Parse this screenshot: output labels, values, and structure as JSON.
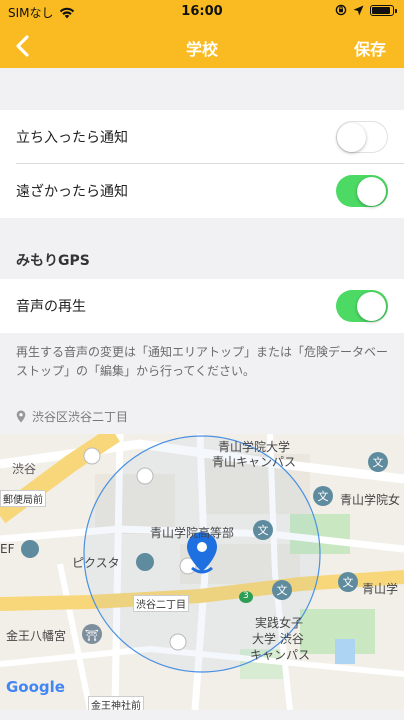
{
  "status_bar": {
    "carrier": "SIMなし",
    "time": "16:00"
  },
  "nav": {
    "back_icon": "chevron-left-icon",
    "title": "学校",
    "save_label": "保存"
  },
  "settings": {
    "notify_enter": {
      "label": "立ち入ったら通知",
      "on": false
    },
    "notify_leave": {
      "label": "遠ざかったら通知",
      "on": true
    }
  },
  "gps_section": {
    "heading": "みもりGPS",
    "voice_playback": {
      "label": "音声の再生",
      "on": true
    },
    "note": "再生する音声の変更は「通知エリアトップ」または「危険データベーストップ」の「編集」から行ってください。"
  },
  "location": {
    "address": "渋谷区渋谷二丁目"
  },
  "map": {
    "labels": {
      "aoyama_univ_1": "青山学院大学",
      "aoyama_univ_2": "青山キャンパス",
      "shibuya": "渋谷",
      "post_office": "郵便局前",
      "aoyama_right": "青山学院女",
      "aoyama_hs": "青山学院高等部",
      "picsta": "ピクスタ",
      "ef": "EF",
      "shibuya2": "渋谷二丁目",
      "route": "3",
      "aoyama_r2": "青山学",
      "jissen_1": "実践女子",
      "jissen_2": "大学 渋谷",
      "jissen_3": "キャンパス",
      "hachiman": "金王八幡宮",
      "konno_shrine": "金王神社前",
      "google": "Google"
    },
    "colors": {
      "pin": "#1e6fe0",
      "circle": "#4a90e2",
      "road_yellow": "#f8d77a",
      "park": "#c9e8c2"
    }
  }
}
